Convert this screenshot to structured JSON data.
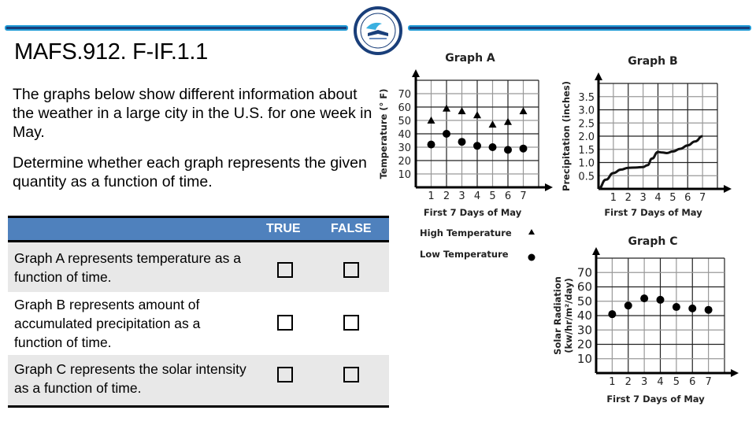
{
  "header": {
    "title": "MAFS.912. F-IF.1.1",
    "logo": "school-district-seal-icon",
    "accent_color": "#1f9ad6",
    "accent_dark": "#1a3f7a"
  },
  "intro": {
    "paragraph1": "The graphs below show different information about the weather in a large city in the U.S. for one week in May.",
    "paragraph2": "Determine whether each graph represents the given quantity as a function of time."
  },
  "table": {
    "header_color": "#4f81bd",
    "columns": [
      "",
      "TRUE",
      "FALSE"
    ],
    "rows": [
      {
        "statement": "Graph A represents temperature as a function of time.",
        "true_checked": false,
        "false_checked": false
      },
      {
        "statement": "Graph B represents amount of accumulated precipitation as a function of time.",
        "true_checked": false,
        "false_checked": false
      },
      {
        "statement": "Graph C represents the solar intensity as a function of time.",
        "true_checked": false,
        "false_checked": false
      }
    ]
  },
  "chart_data": [
    {
      "type": "scatter",
      "title": "Graph A",
      "xlabel": "First 7 Days of May",
      "ylabel": "Temperature (° F)",
      "x": [
        1,
        2,
        3,
        4,
        5,
        6,
        7
      ],
      "xticks": [
        "1",
        "2",
        "3",
        "4",
        "5",
        "6",
        "7"
      ],
      "yticks": [
        "10",
        "20",
        "30",
        "40",
        "50",
        "60",
        "70"
      ],
      "xlim": [
        0,
        8
      ],
      "ylim": [
        0,
        80
      ],
      "grid": true,
      "series": [
        {
          "name": "High Temperature",
          "marker": "triangle",
          "values": [
            50,
            59,
            57,
            54,
            47,
            49,
            57
          ]
        },
        {
          "name": "Low Temperature",
          "marker": "circle",
          "values": [
            32,
            40,
            34,
            31,
            30,
            28,
            29
          ]
        }
      ],
      "legend": [
        {
          "label": "High Temperature",
          "marker": "triangle"
        },
        {
          "label": "Low Temperature",
          "marker": "circle"
        }
      ],
      "legend_position": "below"
    },
    {
      "type": "line",
      "title": "Graph B",
      "xlabel": "First 7 Days of May",
      "ylabel": "Precipitation (inches)",
      "xticks": [
        "1",
        "2",
        "3",
        "4",
        "5",
        "6",
        "7"
      ],
      "yticks": [
        "0.5",
        "1.0",
        "1.5",
        "2.0",
        "2.5",
        "3.0",
        "3.5"
      ],
      "xlim": [
        0,
        8
      ],
      "ylim": [
        0,
        4
      ],
      "grid": true,
      "series": [
        {
          "name": "Accumulated precipitation",
          "x": [
            0,
            0.5,
            1,
            1.5,
            2,
            2.5,
            3,
            3.3,
            3.6,
            4,
            4.3,
            4.6,
            5,
            5.5,
            6,
            6.5,
            7
          ],
          "values": [
            0,
            0.35,
            0.6,
            0.73,
            0.8,
            0.81,
            0.83,
            0.9,
            1.15,
            1.4,
            1.38,
            1.36,
            1.42,
            1.52,
            1.65,
            1.8,
            2.0
          ]
        }
      ]
    },
    {
      "type": "scatter",
      "title": "Graph C",
      "xlabel": "First 7 Days of May",
      "ylabel": "Solar Radiation (kw/hr/m²/day)",
      "x": [
        1,
        2,
        3,
        4,
        5,
        6,
        7
      ],
      "xticks": [
        "1",
        "2",
        "3",
        "4",
        "5",
        "6",
        "7"
      ],
      "yticks": [
        "10",
        "20",
        "30",
        "40",
        "50",
        "60",
        "70"
      ],
      "xlim": [
        0,
        8
      ],
      "ylim": [
        0,
        80
      ],
      "grid": true,
      "series": [
        {
          "name": "Solar Radiation",
          "marker": "circle",
          "values": [
            41,
            47,
            52,
            51,
            46,
            45,
            44
          ]
        }
      ]
    }
  ]
}
